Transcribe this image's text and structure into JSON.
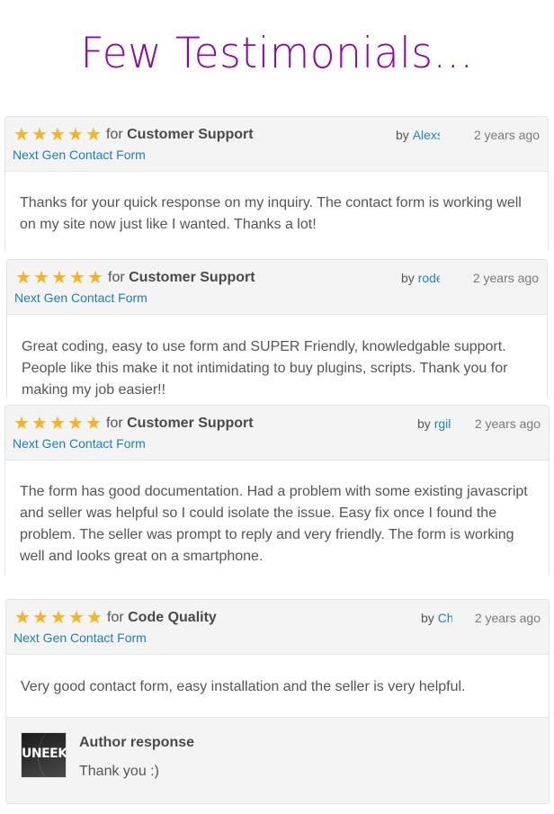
{
  "page": {
    "title": "Few Testimonials..."
  },
  "colors": {
    "title": "#8b0ca3",
    "star": "#f5b324",
    "link": "#1e7fb4"
  },
  "reviews": [
    {
      "rating": 5,
      "star_icon": "★",
      "for_prefix": "for",
      "category": "Customer Support",
      "product": "Next Gen Contact Form",
      "by_prefix": "by",
      "user": "Alexs",
      "time": "2 years ago",
      "text": "Thanks for your quick response on my inquiry. The contact form is working well on my site now just like I wanted. Thanks a lot!"
    },
    {
      "rating": 5,
      "star_icon": "★",
      "for_prefix": "for",
      "category": "Customer Support",
      "product": "Next Gen Contact Form",
      "by_prefix": "by",
      "user": "rode",
      "time": "2 years ago",
      "text": "Great coding, easy to use form and SUPER Friendly, knowledgable support. People like this make it not intimidating to buy plugins, scripts. Thank you for making my job easier!!"
    },
    {
      "rating": 5,
      "star_icon": "★",
      "for_prefix": "for",
      "category": "Customer Support",
      "product": "Next Gen Contact Form",
      "by_prefix": "by",
      "user": "rgil",
      "time": "2 years ago",
      "text": "The form has good documentation. Had a problem with some existing javascript and seller was helpful so I could isolate the issue. Easy fix once I found the problem. The seller was prompt to reply and very friendly. The form is working well and looks great on a smartphone."
    },
    {
      "rating": 5,
      "star_icon": "★",
      "for_prefix": "for",
      "category": "Code Quality",
      "product": "Next Gen Contact Form",
      "by_prefix": "by",
      "user": "Ch",
      "time": "2 years ago",
      "text": "Very good contact form, easy installation and the seller is very helpful.",
      "response": {
        "avatar_logo": "UNEEK",
        "title": "Author response",
        "text": "Thank you :)"
      }
    }
  ]
}
